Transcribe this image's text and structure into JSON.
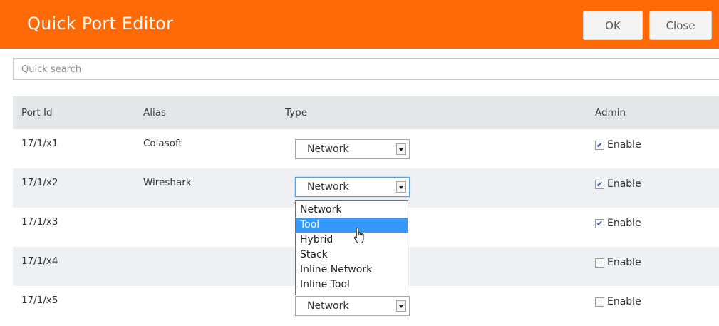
{
  "header": {
    "title": "Quick Port Editor",
    "ok_label": "OK",
    "close_label": "Close"
  },
  "search": {
    "placeholder": "Quick search"
  },
  "table": {
    "columns": {
      "port_id": "Port Id",
      "alias": "Alias",
      "type": "Type",
      "admin": "Admin"
    },
    "rows": [
      {
        "port_id": "17/1/x1",
        "alias": "Colasoft",
        "type": "Network",
        "admin_label": "Enable",
        "admin_checked": true
      },
      {
        "port_id": "17/1/x2",
        "alias": "Wireshark",
        "type": "Network",
        "admin_label": "Enable",
        "admin_checked": true
      },
      {
        "port_id": "17/1/x3",
        "alias": "",
        "type": "",
        "admin_label": "Enable",
        "admin_checked": true
      },
      {
        "port_id": "17/1/x4",
        "alias": "",
        "type": "",
        "admin_label": "Enable",
        "admin_checked": false
      },
      {
        "port_id": "17/1/x5",
        "alias": "",
        "type": "Network",
        "admin_label": "Enable",
        "admin_checked": false
      }
    ]
  },
  "dropdown": {
    "options": [
      "Network",
      "Tool",
      "Hybrid",
      "Stack",
      "Inline Network",
      "Inline Tool"
    ],
    "highlighted": "Tool"
  },
  "colors": {
    "header": "#ff6a06",
    "highlight": "#3399ff"
  }
}
